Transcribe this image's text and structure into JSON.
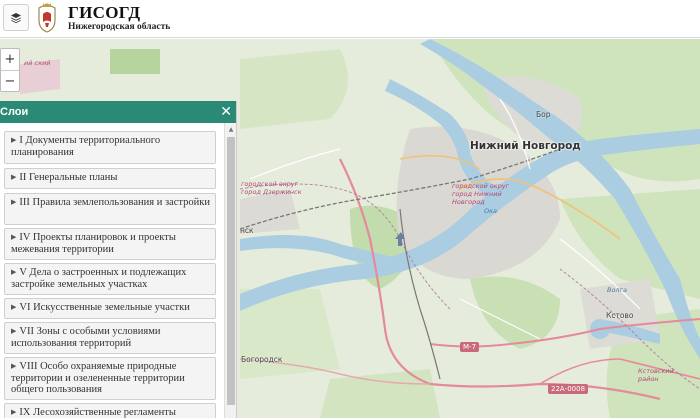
{
  "header": {
    "title": "ГИСОГД",
    "subtitle": "Нижегородская область",
    "layers_button_icon": "layers-icon",
    "logo_icon": "coat-of-arms-icon"
  },
  "zoom": {
    "in_label": "+",
    "out_label": "−"
  },
  "panel": {
    "title": "Слои",
    "close_label": "✕",
    "items": [
      {
        "label": "I Документы территориального планирования"
      },
      {
        "label": "II Генеральные планы"
      },
      {
        "label": "III Правила землепользования и застройки"
      },
      {
        "label": "IV Проекты планировок и проекты межевания территории"
      },
      {
        "label": "V Дела о застроенных и подлежащих застройке земельных участках"
      },
      {
        "label": "VI Искусственные земельные участки"
      },
      {
        "label": "VII Зоны с особыми условиями использования территорий"
      },
      {
        "label": "VIII Особо охраняемые природные территории и озелененные территории общего пользования"
      },
      {
        "label": "IX Лесохозяйственные регламенты лесничеств"
      }
    ]
  },
  "map": {
    "labels": {
      "city": "Нижний Новгород",
      "bor": "Бор",
      "kstovo": "Кстово",
      "bogorodsk": "Богородск",
      "nsk": "нск",
      "oka": "Ока",
      "volga": "Волга",
      "dzerzhinsk_district": "городской округ город Дзержинск",
      "nn_district": "городской округ город Нижний Новгород",
      "kstovo_district": "Кстовский район",
      "top_left_district": "ий ский"
    },
    "shields": {
      "m7": "М-7",
      "r22": "22А-0008"
    },
    "colors": {
      "water": "#a9cde0",
      "forest": "#c5deb0",
      "urban": "#d8d6d2",
      "road_main": "#e58a9a"
    }
  }
}
